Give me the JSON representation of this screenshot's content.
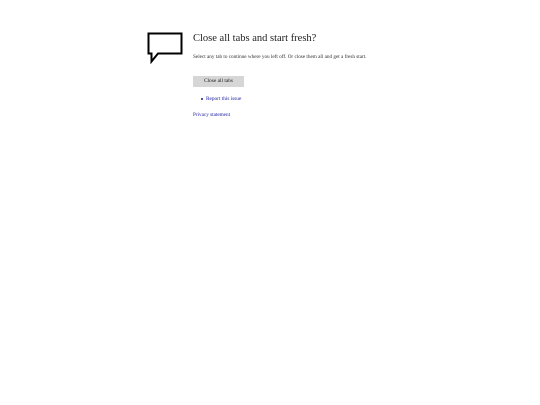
{
  "dialog": {
    "icon": "speech-bubble-icon",
    "title": "Close all tabs and start fresh?",
    "description": "Select any tab to continue where you left off. Or close them all and get a fresh start.",
    "close_button_label": "Close all tabs",
    "links": [
      {
        "label": "Report this issue"
      }
    ],
    "privacy_label": "Privacy statement"
  },
  "colors": {
    "link": "#1a1aa6",
    "button_bg": "#d6d6d6",
    "text": "#222222"
  }
}
